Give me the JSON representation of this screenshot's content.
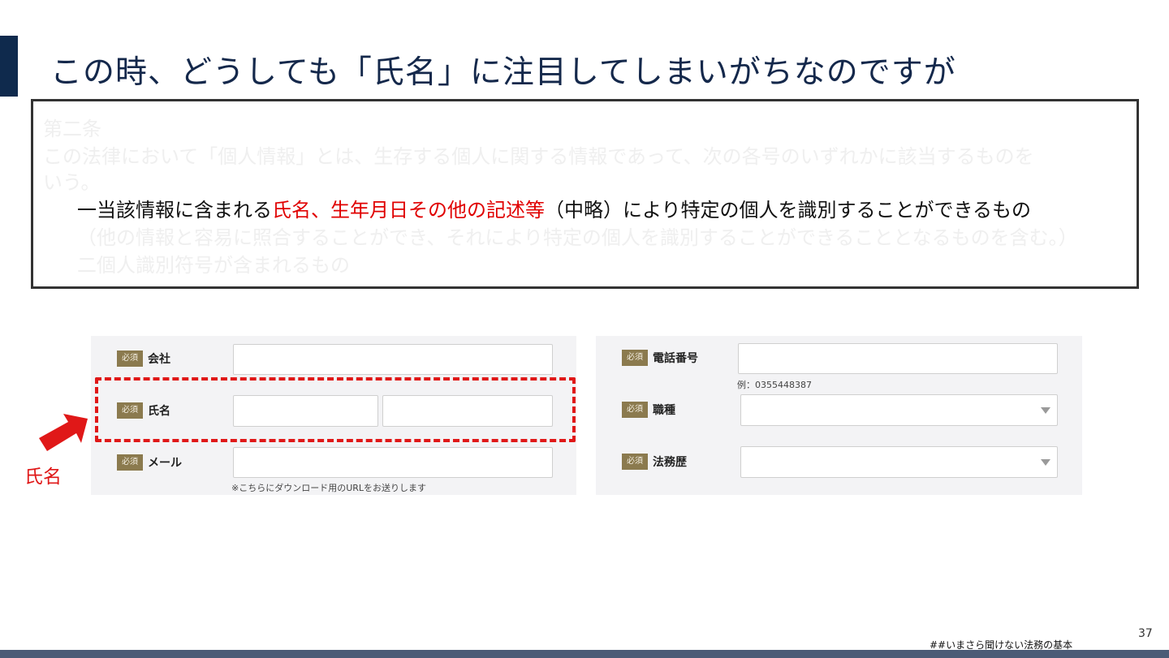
{
  "slide": {
    "title": "この時、どうしても「氏名」に注目してしまいがちなのですが",
    "page_number": "37",
    "footer_tag": "##いまさら聞けない法務の基本"
  },
  "law": {
    "article": "第二条",
    "definition_line1": "この法律において「個人情報」とは、生存する個人に関する情報であって、次の各号のいずれかに該当するものを",
    "definition_line2": "いう。",
    "item1_prefix": "一当該情報に含まれる",
    "item1_highlight": "氏名、生年月日その他の記述等",
    "item1_suffix": "（中略）により特定の個人を識別することができるもの",
    "item1_paren": "（他の情報と容易に照合することができ、それにより特定の個人を識別することができることとなるものを含む。）",
    "item2": "二個人識別符号が含まれるもの"
  },
  "form": {
    "required_badge": "必須",
    "left": {
      "company_label": "会社",
      "name_label": "氏名",
      "email_label": "メール",
      "email_hint": "※こちらにダウンロード用のURLをお送りします"
    },
    "right": {
      "phone_label": "電話番号",
      "phone_hint": "例：0355448387",
      "job_label": "職種",
      "legal_exp_label": "法務歴"
    }
  },
  "annotation": {
    "label": "氏名",
    "highlight_color": "#e01818"
  }
}
